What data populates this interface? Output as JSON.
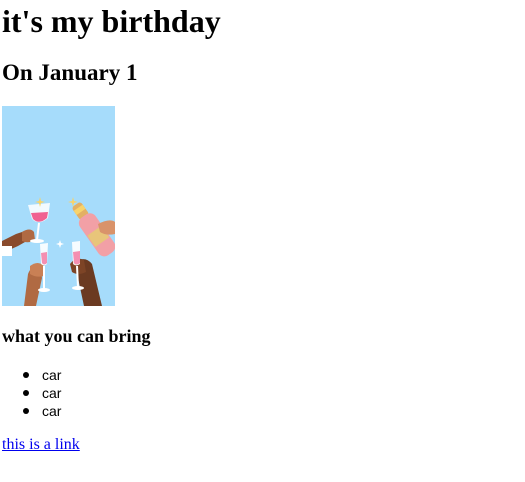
{
  "page": {
    "title": "it's my birthday",
    "subtitle": "On January 1",
    "image_description_icon": "celebration-toast-illustration",
    "bring_heading": "what you can bring",
    "bring_items": [
      {
        "label": "car"
      },
      {
        "label": "car"
      },
      {
        "label": "car"
      }
    ],
    "link_text": "this is a link",
    "colors": {
      "link": "#0000ee",
      "image_background": "#a6dcfb"
    }
  }
}
